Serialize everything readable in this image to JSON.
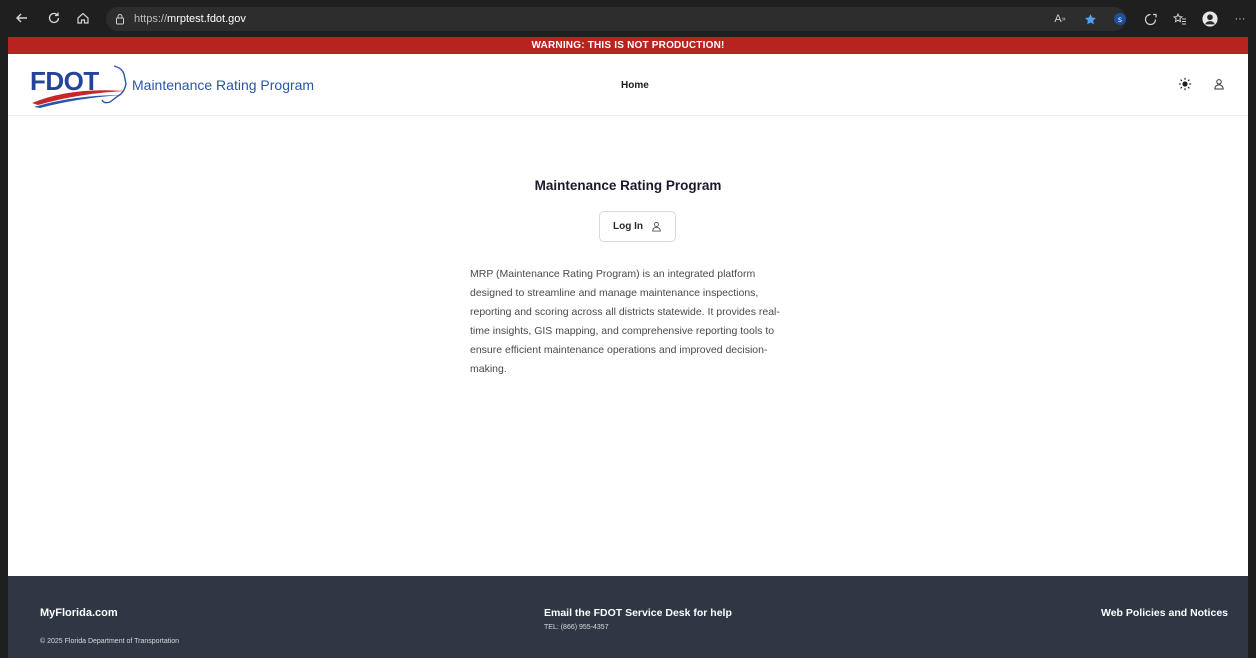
{
  "browser": {
    "url_prefix": "https://",
    "url_host": "mrptest.fdot.gov"
  },
  "banner": {
    "warning_text": "WARNING: THIS IS NOT PRODUCTION!"
  },
  "header": {
    "logo_text": "FDOT",
    "app_title": "Maintenance Rating Program",
    "nav": [
      {
        "label": "Home"
      }
    ]
  },
  "main": {
    "title": "Maintenance Rating Program",
    "login_label": "Log In",
    "description": "MRP (Maintenance Rating Program) is an integrated platform designed to streamline and manage maintenance inspections, reporting and scoring across all districts statewide. It provides real-time insights, GIS mapping, and comprehensive reporting tools to ensure efficient maintenance operations and improved decision-making."
  },
  "footer": {
    "left_link": "MyFlorida.com",
    "copyright": "© 2025 Florida Department of Transportation",
    "center_link": "Email the FDOT Service Desk for help",
    "phone": "TEL: (866) 955-4357",
    "right_link": "Web Policies and Notices"
  },
  "colors": {
    "warning_red": "#b8221f",
    "brand_blue": "#2a56a6",
    "footer_bg": "#2f3744"
  }
}
